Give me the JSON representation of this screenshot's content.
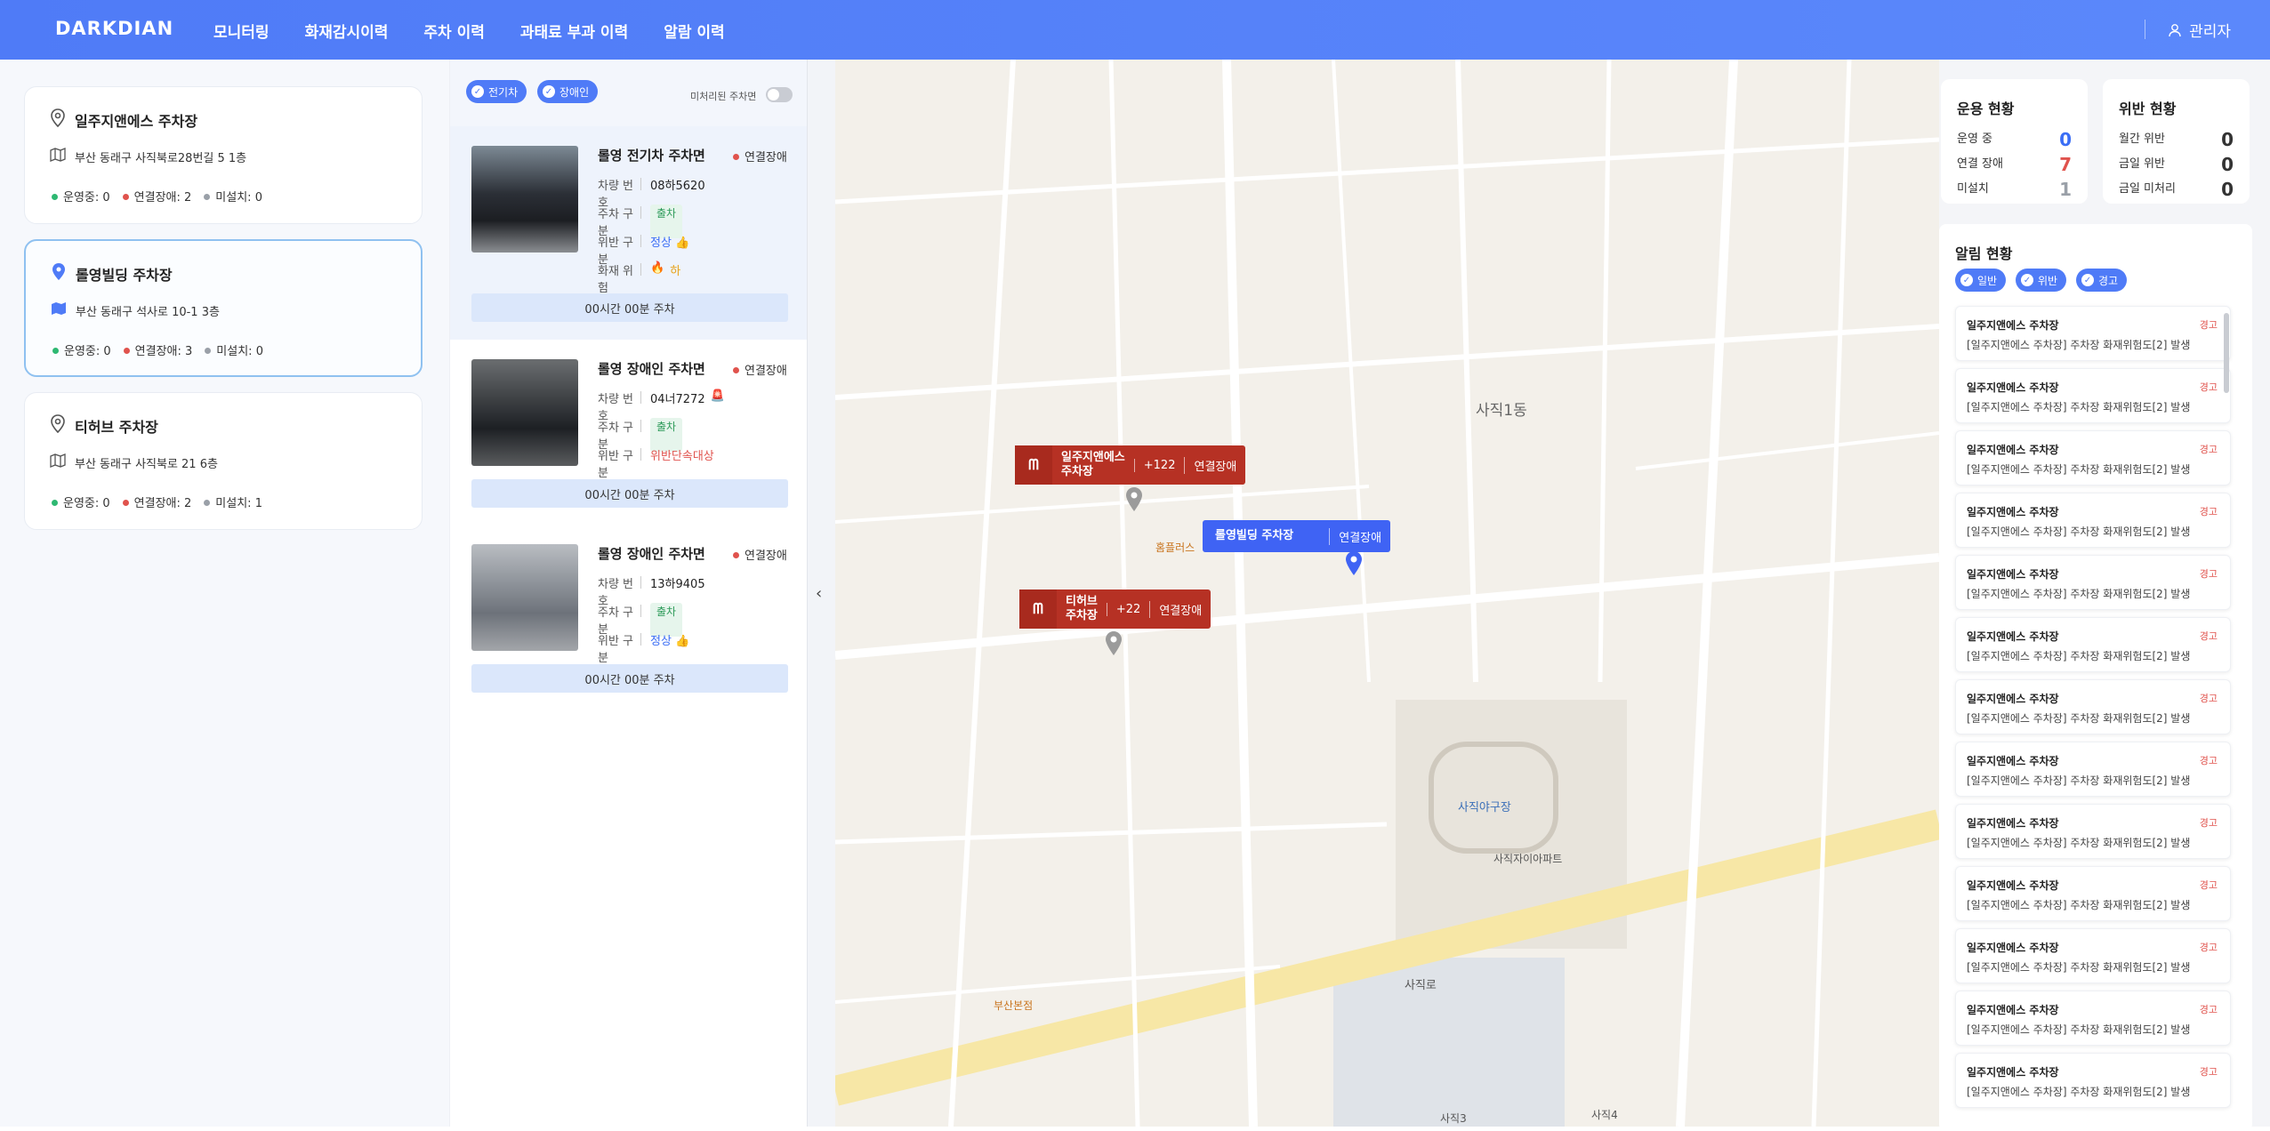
{
  "app": {
    "logo": "DARKDIAN",
    "user_label": "관리자"
  },
  "nav": [
    "모니터링",
    "화재감시이력",
    "주차 이력",
    "과태료 부과 이력",
    "알람 이력"
  ],
  "lots": [
    {
      "name": "일주지앤에스 주차장",
      "address": "부산 동래구 사직북로28번길 5 1층",
      "running": "운영중: 0",
      "conn_err": "연결장애: 2",
      "uninstalled": "미설치: 0"
    },
    {
      "name": "롤영빌딩 주차장",
      "address": "부산 동래구 석사로 10-1 3층",
      "running": "운영중: 0",
      "conn_err": "연결장애: 3",
      "uninstalled": "미설치: 0"
    },
    {
      "name": "티허브 주차장",
      "address": "부산 동래구 사직북로 21 6층",
      "running": "운영중: 0",
      "conn_err": "연결장애: 2",
      "uninstalled": "미설치: 1"
    }
  ],
  "filters": {
    "chip1": "전기차",
    "chip2": "장애인",
    "toggle_label": "미처리된 주차면"
  },
  "cards": [
    {
      "title": "롤영 전기차 주차면",
      "status": "연결장애",
      "plate_k": "차량 번호",
      "plate": "08하5620",
      "type_k": "주차 구분",
      "type": "출차",
      "viol_k": "위반 구분",
      "viol": "정상 👍",
      "fire_k": "화재 위험",
      "fire": "하",
      "duration": "00시간 00분 주차"
    },
    {
      "title": "롤영 장애인 주차면",
      "status": "연결장애",
      "plate_k": "차량 번호",
      "plate": "04너7272",
      "type_k": "주차 구분",
      "type": "출차",
      "viol_k": "위반 구분",
      "viol": "위반단속대상",
      "duration": "00시간 00분 주차"
    },
    {
      "title": "롤영 장애인 주차면",
      "status": "연결장애",
      "plate_k": "차량 번호",
      "plate": "13하9405",
      "type_k": "주차 구분",
      "type": "출차",
      "viol_k": "위반 구분",
      "viol": "정상 👍",
      "duration": "00시간 00분 주차"
    }
  ],
  "map": {
    "markers": [
      {
        "name": "일주지앤에스\n주차장",
        "count": "+122",
        "status": "연결장애"
      },
      {
        "name": "롤영빌딩 주차장",
        "status": "연결장애"
      },
      {
        "name": "티허브\n주차장",
        "count": "+22",
        "status": "연결장애"
      }
    ],
    "labels": [
      "사직1동",
      "사직로",
      "사직3",
      "사직4",
      "사직야구장",
      "부산본점",
      "홈플러스",
      "사직자이아파트"
    ]
  },
  "ops": {
    "title": "운용 현황",
    "rows": [
      {
        "k": "운영 중",
        "v": "0"
      },
      {
        "k": "연결 장애",
        "v": "7"
      },
      {
        "k": "미설치",
        "v": "1"
      }
    ]
  },
  "violations": {
    "title": "위반 현황",
    "rows": [
      {
        "k": "월간 위반",
        "v": "0"
      },
      {
        "k": "금일 위반",
        "v": "0"
      },
      {
        "k": "금일 미처리",
        "v": "0"
      }
    ]
  },
  "alerts": {
    "title": "알림 현황",
    "chips": [
      "일반",
      "위반",
      "경고"
    ],
    "items": [
      {
        "title": "일주지앤에스 주차장",
        "msg": "[일주지앤에스 주차장] 주차장 화재위험도[2] 발생",
        "level": "경고"
      },
      {
        "title": "일주지앤에스 주차장",
        "msg": "[일주지앤에스 주차장] 주차장 화재위험도[2] 발생",
        "level": "경고"
      },
      {
        "title": "일주지앤에스 주차장",
        "msg": "[일주지앤에스 주차장] 주차장 화재위험도[2] 발생",
        "level": "경고"
      },
      {
        "title": "일주지앤에스 주차장",
        "msg": "[일주지앤에스 주차장] 주차장 화재위험도[2] 발생",
        "level": "경고"
      },
      {
        "title": "일주지앤에스 주차장",
        "msg": "[일주지앤에스 주차장] 주차장 화재위험도[2] 발생",
        "level": "경고"
      },
      {
        "title": "일주지앤에스 주차장",
        "msg": "[일주지앤에스 주차장] 주차장 화재위험도[2] 발생",
        "level": "경고"
      },
      {
        "title": "일주지앤에스 주차장",
        "msg": "[일주지앤에스 주차장] 주차장 화재위험도[2] 발생",
        "level": "경고"
      },
      {
        "title": "일주지앤에스 주차장",
        "msg": "[일주지앤에스 주차장] 주차장 화재위험도[2] 발생",
        "level": "경고"
      },
      {
        "title": "일주지앤에스 주차장",
        "msg": "[일주지앤에스 주차장] 주차장 화재위험도[2] 발생",
        "level": "경고"
      },
      {
        "title": "일주지앤에스 주차장",
        "msg": "[일주지앤에스 주차장] 주차장 화재위험도[2] 발생",
        "level": "경고"
      },
      {
        "title": "일주지앤에스 주차장",
        "msg": "[일주지앤에스 주차장] 주차장 화재위험도[2] 발생",
        "level": "경고"
      },
      {
        "title": "일주지앤에스 주차장",
        "msg": "[일주지앤에스 주차장] 주차장 화재위험도[2] 발생",
        "level": "경고"
      },
      {
        "title": "일주지앤에스 주차장",
        "msg": "[일주지앤에스 주차장] 주차장 화재위험도[2] 발생",
        "level": "경고"
      }
    ]
  },
  "colors": {
    "brand": "#4f7bf7",
    "alert_red": "#b63124",
    "ok_blue": "#3b6ef5",
    "error_red": "#e0534d",
    "running_green": "#2eb872",
    "muted_gray": "#9aa0a8"
  }
}
